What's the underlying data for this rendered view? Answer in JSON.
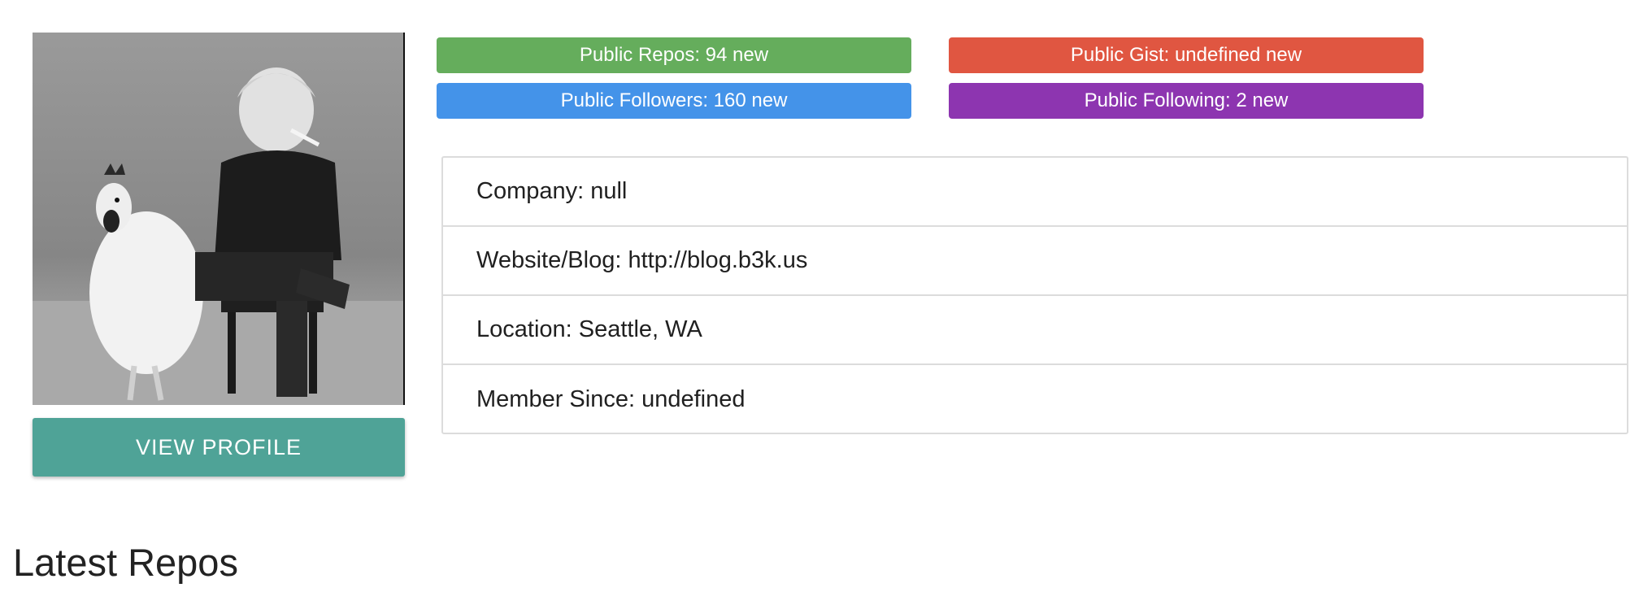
{
  "profile": {
    "view_profile_label": "VIEW PROFILE",
    "button_color": "#4fa397"
  },
  "badges": {
    "repos": "Public Repos: 94 new",
    "gists": "Public Gist: undefined new",
    "followers": "Public Followers: 160 new",
    "following": "Public Following: 2 new",
    "colors": {
      "repos": "#65ad5c",
      "gists": "#e05641",
      "followers": "#4493e9",
      "following": "#8d35b0"
    }
  },
  "info": {
    "company": "Company: null",
    "website": "Website/Blog: http://blog.b3k.us",
    "location": "Location: Seattle, WA",
    "member_since": "Member Since: undefined"
  },
  "sections": {
    "latest_repos_title": "Latest Repos"
  }
}
